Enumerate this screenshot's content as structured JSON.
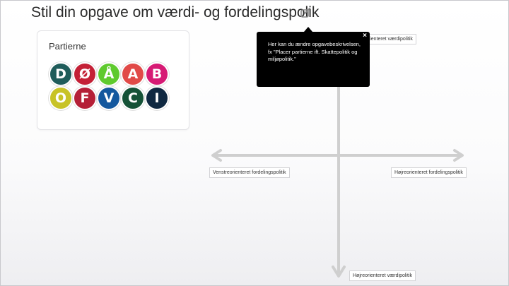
{
  "page": {
    "title": "Stil din opgave om værdi- og fordelingspolik"
  },
  "card": {
    "title": "Partierne",
    "parties": [
      {
        "letter": "D",
        "color": "#1f5c5a"
      },
      {
        "letter": "Ø",
        "color": "#c42036"
      },
      {
        "letter": "Å",
        "color": "#5fca2e"
      },
      {
        "letter": "A",
        "color": "#e14a48"
      },
      {
        "letter": "B",
        "color": "#d61a74"
      },
      {
        "letter": "O",
        "color": "#c8c327"
      },
      {
        "letter": "F",
        "color": "#b51f37"
      },
      {
        "letter": "V",
        "color": "#14589e"
      },
      {
        "letter": "C",
        "color": "#155237"
      },
      {
        "letter": "I",
        "color": "#0f2841"
      }
    ]
  },
  "axes": {
    "top_label": "Venstreorienteret værdipolitik",
    "top_label_visible": "orienteret værdipolitik",
    "bottom_label": "Højreorienteret værdipolitik",
    "left_label": "Venstreorienteret fordelingspolitik",
    "right_label": "Højreorienteret fordelingspolitik"
  },
  "tooltip": {
    "text": "Her kan du ændre opgavebeskrivelsen, fx \"Placer partierne ift. Skattepolitik og miljøpolitik.\"",
    "close": "×"
  },
  "colors": {
    "axis": "#cfcfcf",
    "tooltip_bg": "#000000"
  }
}
